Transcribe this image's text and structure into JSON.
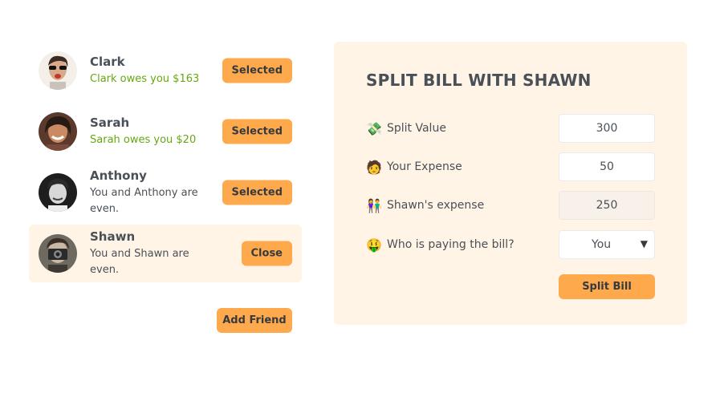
{
  "friends": [
    {
      "name": "Clark",
      "status": "Clark owes you $163",
      "status_type": "owes",
      "button": "Selected",
      "selected": false
    },
    {
      "name": "Sarah",
      "status": "Sarah owes you $20",
      "status_type": "owes",
      "button": "Selected",
      "selected": false
    },
    {
      "name": "Anthony",
      "status": "You and Anthony are even.",
      "status_type": "even",
      "button": "Selected",
      "selected": false
    },
    {
      "name": "Shawn",
      "status": "You and Shawn are even.",
      "status_type": "even",
      "button": "Close",
      "selected": true
    }
  ],
  "add_friend_label": "Add Friend",
  "split": {
    "title": "SPLIT BILL WITH SHAWN",
    "bill_label": "Split Value",
    "bill_icon": "money-icon",
    "bill_value": "300",
    "your_label": "Your Expense",
    "your_icon": "person-icon",
    "your_value": "50",
    "friend_label": "Shawn's expense",
    "friend_icon": "couple-icon",
    "friend_value": "250",
    "payer_label": "Who is paying the bill?",
    "payer_icon": "money-face-icon",
    "payer_value": "You",
    "submit_label": "Split Bill"
  },
  "colors": {
    "accent": "#ffa94d",
    "panel_bg": "#fff4e6",
    "owes_text": "#66a80f",
    "text": "#495057"
  }
}
